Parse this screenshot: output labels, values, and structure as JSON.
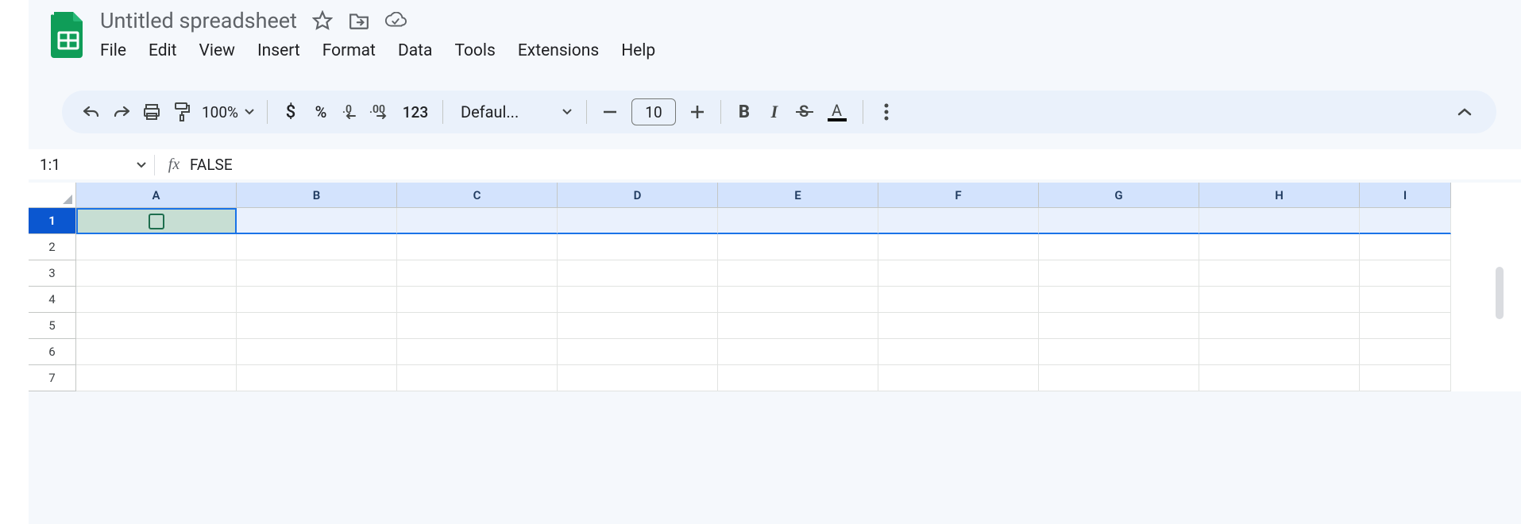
{
  "doc_title": "Untitled spreadsheet",
  "menubar": [
    "File",
    "Edit",
    "View",
    "Insert",
    "Format",
    "Data",
    "Tools",
    "Extensions",
    "Help"
  ],
  "toolbar": {
    "zoom": "100%",
    "font": "Defaul...",
    "font_size": "10",
    "num_123": "123"
  },
  "name_box": "1:1",
  "formula": "FALSE",
  "columns": [
    "A",
    "B",
    "C",
    "D",
    "E",
    "F",
    "G",
    "H",
    "I"
  ],
  "rows": [
    "1",
    "2",
    "3",
    "4",
    "5",
    "6",
    "7"
  ]
}
